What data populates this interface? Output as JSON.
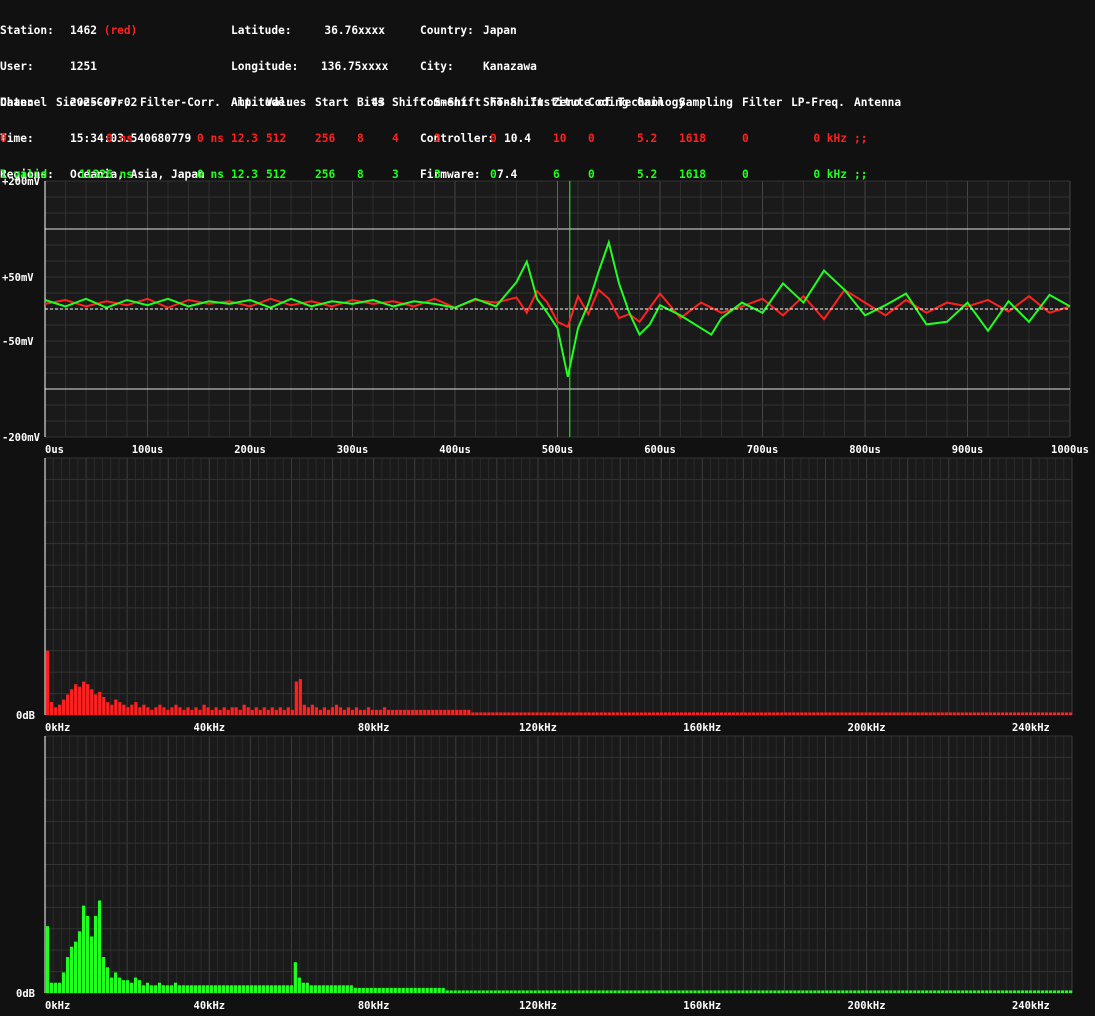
{
  "station": {
    "station_label": "Station:",
    "station_value": "1462",
    "station_color": "(red)",
    "user_label": "User:",
    "user_value": "1251",
    "date_label": "Date:",
    "date_value": "2025-07-02",
    "time_label": "Time:",
    "time_value": "15:34:03.540680779",
    "regions_label": "Regions:",
    "regions_value": "Oceania, Asia, Japan"
  },
  "location": {
    "lat_label": "Latitude:",
    "lat_value": "36.76xxxx",
    "lon_label": "Longitude:",
    "lon_value": "136.75xxxx",
    "alt_label": "Altitude:",
    "alt_value": "43"
  },
  "meta": {
    "country_label": "Country:",
    "country_value": "Japan",
    "city_label": "City:",
    "city_value": "Kanazawa",
    "comment_label": "Comment:",
    "comment_value": "Shonan Institute of Technology",
    "controller_label": "Controller:",
    "controller_value": "10.4",
    "firmware_label": "Firmware:",
    "firmware_value": "7.4"
  },
  "channels": {
    "headers": [
      "Channel",
      "Sieve-Corr.",
      "Filter-Corr.",
      "Amp.",
      "Values",
      "Start",
      "Bits",
      "Shift",
      "S-Shift",
      "FT-Shift",
      "Zero",
      "Coding",
      "Gain",
      "Sampling",
      "Filter",
      "LP-Freq.",
      "Antenna"
    ],
    "rows": [
      {
        "channel": "0",
        "sieve": "0 ns",
        "filter_corr": "0 ns",
        "amp": "12.3",
        "values": "512",
        "start": "256",
        "bits": "8",
        "shift": "4",
        "s_shift": "3",
        "ft_shift": "0",
        "zero": "10",
        "coding": "0",
        "gain": "5.2",
        "sampling": "1618",
        "filter": "0",
        "lp_freq": "0 kHz",
        "antenna": ";;",
        "color": "#ff2020"
      },
      {
        "channel": "1 valid",
        "sieve": "11326 ns",
        "filter_corr": "0 ns",
        "amp": "12.3",
        "values": "512",
        "start": "256",
        "bits": "8",
        "shift": "3",
        "s_shift": "3",
        "ft_shift": "0",
        "zero": "6",
        "coding": "0",
        "gain": "5.2",
        "sampling": "1618",
        "filter": "0",
        "lp_freq": "0 kHz",
        "antenna": ";;",
        "color": "#20ff20"
      }
    ]
  },
  "colors": {
    "red": "#ff2020",
    "green": "#20ff20",
    "background": "#111111",
    "grid": "#3a3a3a"
  },
  "chart_data": [
    {
      "type": "line",
      "title": "",
      "x_unit": "us",
      "xlim": [
        0,
        1000
      ],
      "ylim": [
        -200,
        200
      ],
      "y_unit": "mV",
      "y_tick_labels": [
        "+200mV",
        "+50mV",
        "-50mV",
        "-200mV"
      ],
      "y_tick_values": [
        200,
        50,
        -50,
        -200
      ],
      "x_tick_labels": [
        "0us",
        "100us",
        "200us",
        "300us",
        "400us",
        "500us",
        "600us",
        "700us",
        "800us",
        "900us",
        "1000us"
      ],
      "threshold_lines": [
        125,
        -125
      ],
      "markers": [
        {
          "x": 500,
          "color": "#ff2020"
        },
        {
          "x": 512,
          "color": "#20ff20"
        }
      ],
      "grid": true,
      "series": [
        {
          "color": "#ff2020",
          "x": [
            0,
            20,
            40,
            60,
            80,
            100,
            120,
            140,
            160,
            180,
            200,
            220,
            240,
            260,
            280,
            300,
            320,
            340,
            360,
            380,
            400,
            420,
            440,
            460,
            470,
            480,
            490,
            500,
            510,
            520,
            530,
            540,
            550,
            560,
            570,
            580,
            600,
            620,
            640,
            660,
            680,
            700,
            720,
            740,
            760,
            780,
            800,
            820,
            840,
            860,
            880,
            900,
            920,
            940,
            960,
            980,
            1000
          ],
          "y": [
            8,
            14,
            4,
            12,
            6,
            16,
            2,
            14,
            8,
            12,
            4,
            16,
            6,
            12,
            4,
            14,
            8,
            12,
            4,
            16,
            2,
            14,
            10,
            18,
            -6,
            28,
            10,
            -20,
            -28,
            20,
            -8,
            30,
            16,
            -14,
            -8,
            -20,
            24,
            -14,
            10,
            -6,
            4,
            16,
            -10,
            20,
            -16,
            30,
            10,
            -10,
            14,
            -6,
            10,
            4,
            14,
            -4,
            20,
            -6,
            4
          ]
        },
        {
          "color": "#20ff20",
          "x": [
            0,
            20,
            40,
            60,
            80,
            100,
            120,
            140,
            160,
            180,
            200,
            220,
            240,
            260,
            280,
            300,
            320,
            340,
            360,
            380,
            400,
            420,
            440,
            460,
            470,
            480,
            490,
            500,
            510,
            520,
            530,
            540,
            550,
            560,
            570,
            580,
            590,
            600,
            620,
            640,
            650,
            660,
            680,
            700,
            720,
            740,
            760,
            780,
            800,
            820,
            840,
            860,
            880,
            900,
            920,
            940,
            960,
            980,
            1000
          ],
          "y": [
            14,
            4,
            16,
            2,
            14,
            6,
            16,
            4,
            12,
            8,
            14,
            2,
            16,
            4,
            12,
            8,
            14,
            4,
            12,
            8,
            2,
            16,
            4,
            42,
            74,
            16,
            -6,
            -30,
            -106,
            -30,
            8,
            58,
            104,
            40,
            -6,
            -40,
            -24,
            6,
            -10,
            -30,
            -40,
            -14,
            10,
            -6,
            40,
            10,
            60,
            30,
            -10,
            6,
            24,
            -24,
            -20,
            10,
            -34,
            12,
            -20,
            22,
            4
          ]
        }
      ]
    },
    {
      "type": "bar",
      "title": "",
      "x_unit": "kHz",
      "xlim": [
        0,
        250
      ],
      "y_tick_labels": [
        "0dB"
      ],
      "x_tick_labels": [
        "0kHz",
        "40kHz",
        "80kHz",
        "120kHz",
        "160kHz",
        "200kHz",
        "240kHz"
      ],
      "color": "#ff2020",
      "values": [
        25,
        5,
        3,
        4,
        6,
        8,
        10,
        12,
        11,
        13,
        12,
        10,
        8,
        9,
        7,
        5,
        4,
        6,
        5,
        4,
        3,
        4,
        5,
        3,
        4,
        3,
        2,
        3,
        4,
        3,
        2,
        3,
        4,
        3,
        2,
        3,
        2,
        3,
        2,
        4,
        3,
        2,
        3,
        2,
        3,
        2,
        3,
        3,
        2,
        4,
        3,
        2,
        3,
        2,
        3,
        2,
        3,
        2,
        3,
        2,
        3,
        2,
        13,
        14,
        4,
        3,
        4,
        3,
        2,
        3,
        2,
        3,
        4,
        3,
        2,
        3,
        2,
        3,
        2,
        2,
        3,
        2,
        2,
        2,
        3,
        2,
        2,
        2,
        2,
        2,
        2,
        2,
        2,
        2,
        2,
        2,
        2,
        2,
        2,
        2,
        2,
        2,
        2,
        2,
        2,
        2,
        1,
        1,
        1,
        1,
        1,
        1,
        1,
        1,
        1,
        1,
        1,
        1,
        1,
        1,
        1,
        1,
        1,
        1,
        1,
        1,
        1,
        1,
        1,
        1,
        1,
        1,
        1,
        1,
        1,
        1,
        1,
        1,
        1,
        1,
        1,
        1,
        1,
        1,
        1,
        1,
        1,
        1,
        1,
        1,
        1,
        1,
        1,
        1,
        1,
        1,
        1,
        1,
        1,
        1,
        1,
        1,
        1,
        1,
        1,
        1,
        1,
        1,
        1,
        1,
        1,
        1,
        1,
        1,
        1,
        1,
        1,
        1,
        1,
        1,
        1,
        1,
        1,
        1,
        1,
        1,
        1,
        1,
        1,
        1,
        1,
        1,
        1,
        1,
        1,
        1,
        1,
        1,
        1,
        1,
        1,
        1,
        1,
        1,
        1,
        1,
        1,
        1,
        1,
        1,
        1,
        1,
        1,
        1,
        1,
        1,
        1,
        1,
        1,
        1,
        1,
        1,
        1,
        1,
        1,
        1,
        1,
        1,
        1,
        1,
        1,
        1,
        1,
        1,
        1,
        1,
        1,
        1,
        1,
        1,
        1,
        1,
        1,
        1,
        1,
        1,
        1,
        1,
        1,
        1,
        1,
        1,
        1,
        1,
        1,
        1
      ],
      "ylim": [
        0,
        100
      ],
      "grid": true
    },
    {
      "type": "bar",
      "title": "",
      "x_unit": "kHz",
      "xlim": [
        0,
        250
      ],
      "y_tick_labels": [
        "0dB"
      ],
      "x_tick_labels": [
        "0kHz",
        "40kHz",
        "80kHz",
        "120kHz",
        "160kHz",
        "200kHz",
        "240kHz"
      ],
      "color": "#20ff20",
      "values": [
        26,
        4,
        4,
        4,
        8,
        14,
        18,
        20,
        24,
        34,
        30,
        22,
        30,
        36,
        14,
        10,
        6,
        8,
        6,
        5,
        5,
        4,
        6,
        5,
        3,
        4,
        3,
        3,
        4,
        3,
        3,
        3,
        4,
        3,
        3,
        3,
        3,
        3,
        3,
        3,
        3,
        3,
        3,
        3,
        3,
        3,
        3,
        3,
        3,
        3,
        3,
        3,
        3,
        3,
        3,
        3,
        3,
        3,
        3,
        3,
        3,
        3,
        12,
        6,
        4,
        4,
        3,
        3,
        3,
        3,
        3,
        3,
        3,
        3,
        3,
        3,
        3,
        2,
        2,
        2,
        2,
        2,
        2,
        2,
        2,
        2,
        2,
        2,
        2,
        2,
        2,
        2,
        2,
        2,
        2,
        2,
        2,
        2,
        2,
        2,
        1,
        1,
        1,
        1,
        1,
        1,
        1,
        1,
        1,
        1,
        1,
        1,
        1,
        1,
        1,
        1,
        1,
        1,
        1,
        1,
        1,
        1,
        1,
        1,
        1,
        1,
        1,
        1,
        1,
        1,
        1,
        1,
        1,
        1,
        1,
        1,
        1,
        1,
        1,
        1,
        1,
        1,
        1,
        1,
        1,
        1,
        1,
        1,
        1,
        1,
        1,
        1,
        1,
        1,
        1,
        1,
        1,
        1,
        1,
        1,
        1,
        1,
        1,
        1,
        1,
        1,
        1,
        1,
        1,
        1,
        1,
        1,
        1,
        1,
        1,
        1,
        1,
        1,
        1,
        1,
        1,
        1,
        1,
        1,
        1,
        1,
        1,
        1,
        1,
        1,
        1,
        1,
        1,
        1,
        1,
        1,
        1,
        1,
        1,
        1,
        1,
        1,
        1,
        1,
        1,
        1,
        1,
        1,
        1,
        1,
        1,
        1,
        1,
        1,
        1,
        1,
        1,
        1,
        1,
        1,
        1,
        1,
        1,
        1,
        1,
        1,
        1,
        1,
        1,
        1,
        1,
        1,
        1,
        1,
        1,
        1,
        1,
        1,
        1,
        1,
        1,
        1,
        1,
        1,
        1,
        1,
        1,
        1,
        1,
        1,
        1,
        1,
        1,
        1,
        1,
        1,
        1
      ],
      "ylim": [
        0,
        100
      ],
      "grid": true
    }
  ]
}
